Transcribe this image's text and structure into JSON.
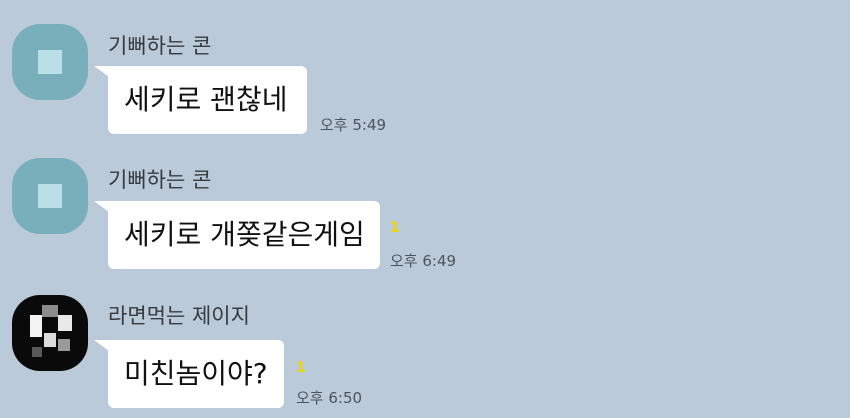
{
  "chat": {
    "messages": [
      {
        "sender": "기뻐하는 콘",
        "text": "세키로 괜찮네",
        "time": "오후 5:49",
        "unread": ""
      },
      {
        "sender": "기뻐하는 콘",
        "text": "세키로 개쫒같은게임",
        "time": "오후 6:49",
        "unread": "1"
      },
      {
        "sender": "라면먹는 제이지",
        "text": "미친놈이야?",
        "time": "오후 6:50",
        "unread": "1"
      }
    ]
  },
  "colors": {
    "background": "#bacad8",
    "bubble": "#ffffff",
    "unread": "#f2d500",
    "avatar_teal": "#78afba"
  },
  "icons": [
    "avatar-placeholder-icon",
    "avatar-pixelated-icon"
  ]
}
